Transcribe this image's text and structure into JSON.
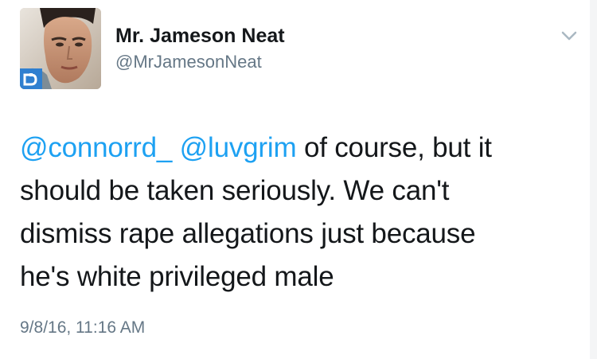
{
  "tweet": {
    "author": {
      "display_name": "Mr. Jameson Neat",
      "handle": "@MrJamesonNeat"
    },
    "menu_icon": "chevron-down-icon",
    "text": {
      "mention_1": "@connorrd_",
      "mention_2": "@luvgrim",
      "line_1_rest": "of course, but it",
      "line_2": "should be taken seriously. We can't",
      "line_3": "dismiss rape allegations just because",
      "line_4": "he's white privileged male"
    },
    "timestamp": "9/8/16, 11:16 AM"
  },
  "colors": {
    "mention": "#1da1f2",
    "secondary_text": "#657786",
    "primary_text": "#14171a"
  }
}
